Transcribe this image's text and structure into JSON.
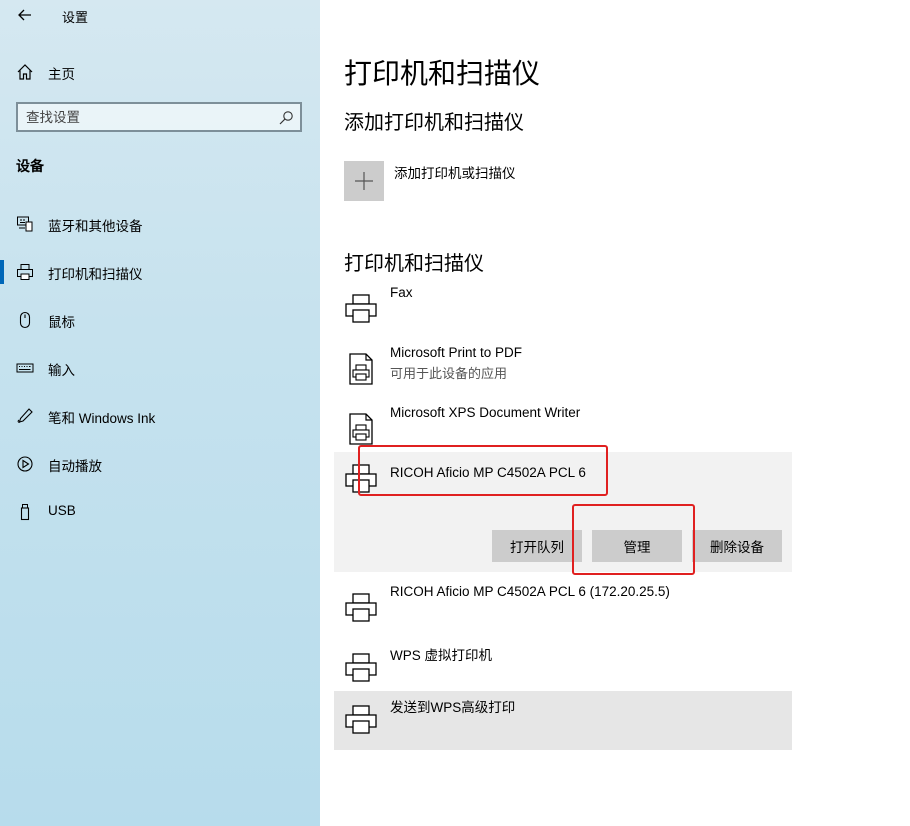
{
  "window": {
    "title": "设置"
  },
  "sidebar": {
    "home_label": "主页",
    "search_placeholder": "查找设置",
    "section_title": "设备",
    "items": [
      {
        "label": "蓝牙和其他设备",
        "icon": "bluetooth-devices-icon"
      },
      {
        "label": "打印机和扫描仪",
        "icon": "printer-icon",
        "active": true
      },
      {
        "label": "鼠标",
        "icon": "mouse-icon"
      },
      {
        "label": "输入",
        "icon": "keyboard-icon"
      },
      {
        "label": "笔和 Windows Ink",
        "icon": "pen-icon"
      },
      {
        "label": "自动播放",
        "icon": "autoplay-icon"
      },
      {
        "label": "USB",
        "icon": "usb-icon"
      }
    ]
  },
  "main": {
    "title": "打印机和扫描仪",
    "add_section_title": "添加打印机和扫描仪",
    "add_button_label": "添加打印机或扫描仪",
    "list_section_title": "打印机和扫描仪",
    "devices": [
      {
        "name": "Fax",
        "status": "",
        "icon": "printer-icon"
      },
      {
        "name": "Microsoft Print to PDF",
        "status": "可用于此设备的应用",
        "icon": "document-printer-icon"
      },
      {
        "name": "Microsoft XPS Document Writer",
        "status": "",
        "icon": "document-printer-icon"
      },
      {
        "name": "RICOH Aficio MP C4502A PCL 6",
        "status": "",
        "icon": "printer-icon",
        "expanded": true
      },
      {
        "name": "RICOH Aficio MP C4502A PCL 6 (172.20.25.5)",
        "status": "",
        "icon": "printer-icon"
      },
      {
        "name": "WPS 虚拟打印机",
        "status": "",
        "icon": "printer-icon"
      },
      {
        "name": "发送到WPS高级打印",
        "status": "",
        "icon": "printer-icon",
        "hover": true
      }
    ],
    "expanded_actions": {
      "open_queue": "打开队列",
      "manage": "管理",
      "remove": "删除设备"
    }
  },
  "colors": {
    "accent": "#0067b8",
    "annotation": "#e02020",
    "button": "#cccccc"
  }
}
